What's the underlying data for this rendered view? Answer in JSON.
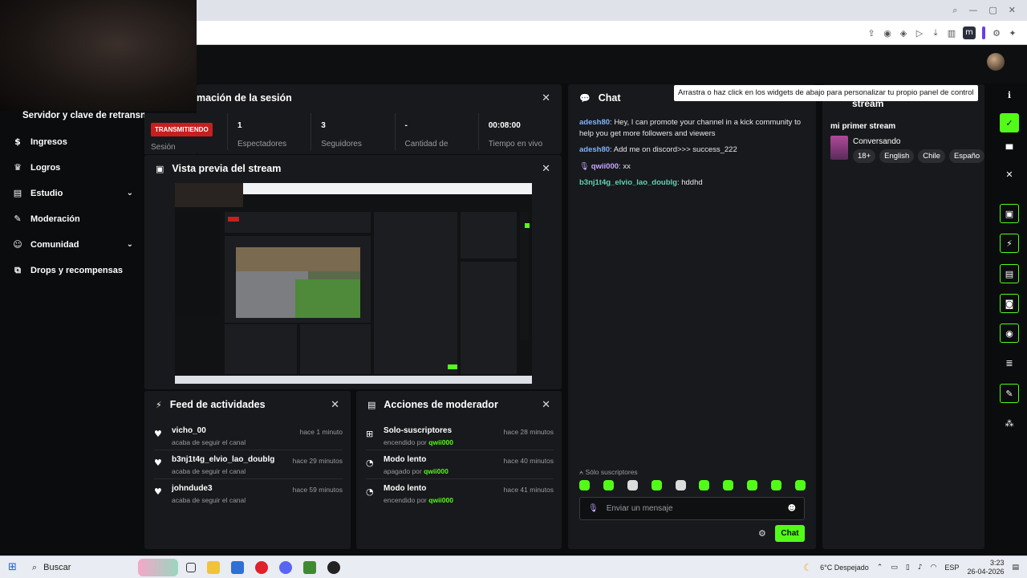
{
  "session": {
    "title": "mación de la sesión",
    "status_badge": "TRANSMITIENDO",
    "status_label": "Sesión",
    "stats": [
      {
        "value": "1",
        "label": "Espectadores"
      },
      {
        "value": "3",
        "label": "Seguidores"
      },
      {
        "value": "-",
        "label": "Cantidad de"
      },
      {
        "value": "00:08:00",
        "label": "Tiempo en vivo"
      }
    ]
  },
  "sidebar": {
    "title": "Servidor y clave de retransn",
    "items": [
      {
        "label": "Ingresos",
        "icon": "dollar-icon",
        "glyph": "$"
      },
      {
        "label": "Logros",
        "icon": "trophy-icon",
        "glyph": "♛"
      },
      {
        "label": "Estudio",
        "icon": "studio-icon",
        "glyph": "▤"
      },
      {
        "label": "Moderación",
        "icon": "wrench-icon",
        "glyph": "✎"
      },
      {
        "label": "Comunidad",
        "icon": "community-icon",
        "glyph": "☺"
      },
      {
        "label": "Drops y recompensas",
        "icon": "drops-icon",
        "glyph": "⧉"
      }
    ]
  },
  "preview": {
    "title": "Vista previa del stream"
  },
  "feed": {
    "title": "Feed de actividades",
    "items": [
      {
        "name": "vicho_00",
        "action": "acaba de seguir el canal",
        "time": "hace 1 minuto"
      },
      {
        "name": "b3nj1t4g_elvio_lao_doublg",
        "action": "acaba de seguir el canal",
        "time": "hace 29 minutos"
      },
      {
        "name": "johndude3",
        "action": "acaba de seguir el canal",
        "time": "hace 59 minutos"
      }
    ]
  },
  "mod_actions": {
    "title": "Acciones de moderador",
    "items": [
      {
        "name": "Solo-suscriptores",
        "state": "encendido por",
        "by": "qwii000",
        "time": "hace 28 minutos"
      },
      {
        "name": "Modo lento",
        "state": "apagado por",
        "by": "qwii000",
        "time": "hace 40 minutos"
      },
      {
        "name": "Modo lento",
        "state": "encendido por",
        "by": "qwii000",
        "time": "hace 41 minutos"
      }
    ]
  },
  "chat": {
    "title": "Chat",
    "messages": [
      {
        "user": "adesh80",
        "text": "Hey, I can promote your channel in a kick community to help you get more followers and viewers",
        "color": "#7fb3ff"
      },
      {
        "user": "adesh80",
        "text": "Add me on discord>>> success_222",
        "color": "#7fb3ff"
      },
      {
        "user": "qwii000",
        "text": "xx",
        "color": "#c7a6ff"
      },
      {
        "user": "b3nj1t4g_elvio_lao_doublg",
        "text": "hddhd",
        "color": "#5fd3b5"
      }
    ],
    "sub_only_label": "Sólo suscriptores",
    "input_placeholder": "Enviar un mensaje",
    "send_label": "Chat"
  },
  "stream_info": {
    "header": "stream",
    "title": "mi primer stream",
    "category": "Conversando",
    "tags": [
      "18+",
      "English",
      "Chile",
      "Españo"
    ]
  },
  "tooltip": "Arrastra o haz click en los widgets de abajo para personalizar tu propio panel de control",
  "taskbar": {
    "search": "Buscar",
    "weather": "6°C Despejado",
    "lang": "ESP",
    "time": "3:23",
    "date": "26-04-2026"
  },
  "colors": {
    "accent": "#53fc18",
    "live": "#c71f1f",
    "panel": "#18191c"
  }
}
